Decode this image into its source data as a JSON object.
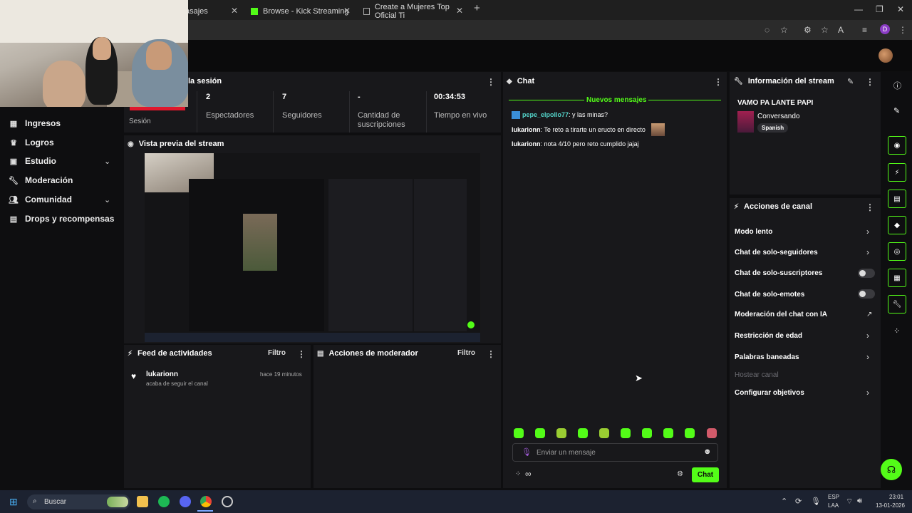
{
  "browser": {
    "tabs": [
      {
        "label": "asajes"
      },
      {
        "label": "Browse - Kick Streaming"
      },
      {
        "label": "Create a Mujeres Top Oficial Ti"
      }
    ],
    "profile_initial": "D"
  },
  "sidebar": {
    "items": [
      {
        "label": "Ingresos",
        "icon": "income-icon"
      },
      {
        "label": "Logros",
        "icon": "trophy-icon"
      },
      {
        "label": "Estudio",
        "icon": "studio-icon"
      },
      {
        "label": "Moderación",
        "icon": "wrench-icon"
      },
      {
        "label": "Comunidad",
        "icon": "community-icon"
      },
      {
        "label": "Drops y recompensas",
        "icon": "drops-icon"
      }
    ]
  },
  "session": {
    "title": "la sesión",
    "first_label": "Sesión",
    "stats": [
      {
        "value": "2",
        "label": "Espectadores"
      },
      {
        "value": "7",
        "label": "Seguidores"
      },
      {
        "value": "-",
        "label": "Cantidad de suscripciones"
      },
      {
        "value": "00:34:53",
        "label": "Tiempo en vivo"
      }
    ]
  },
  "preview": {
    "title": "Vista previa del stream"
  },
  "activity": {
    "title": "Feed de actividades",
    "filter": "Filtro",
    "item": {
      "user": "lukarionn",
      "time": "hace 19 minutos",
      "text": "acaba de seguir el canal"
    }
  },
  "mod_actions": {
    "title": "Acciones de moderador",
    "filter": "Filtro"
  },
  "chat": {
    "title": "Chat",
    "new_messages": "Nuevos mensajes",
    "messages": [
      {
        "user": "pepe_elpollo77",
        "text": ": y las minas?",
        "color": "#53d2c8"
      },
      {
        "user": "lukarionn",
        "text": ": Te reto a tirarte un eructo en directo",
        "color": "#ffffff"
      },
      {
        "user": "lukarionn",
        "text": ": nota 4/10 pero reto cumplido jajaj",
        "color": "#ffffff"
      }
    ],
    "input_placeholder": "Enviar un mensaje",
    "send_label": "Chat"
  },
  "stream_info": {
    "title": "Información del stream",
    "stream_title": "VAMO PA LANTE PAPI",
    "category": "Conversando",
    "language": "Spanish"
  },
  "channel_actions": {
    "title": "Acciones de canal",
    "items": [
      {
        "label": "Modo lento",
        "control": "chevron"
      },
      {
        "label": "Chat de solo-seguidores",
        "control": "chevron"
      },
      {
        "label": "Chat de solo-suscriptores",
        "control": "toggle"
      },
      {
        "label": "Chat de solo-emotes",
        "control": "toggle"
      },
      {
        "label": "Moderación del chat con IA",
        "control": "external"
      },
      {
        "label": "Restricción de edad",
        "control": "chevron"
      },
      {
        "label": "Palabras baneadas",
        "control": "chevron"
      },
      {
        "label": "Hostear canal",
        "control": "none"
      },
      {
        "label": "Configurar objetivos",
        "control": "chevron"
      }
    ]
  },
  "taskbar": {
    "search_label": "Buscar",
    "lang": "ESP",
    "layout": "LAA",
    "time": "23:01",
    "date": "13-01-2026"
  },
  "colors": {
    "accent": "#53fc18",
    "panel": "#18181b",
    "background": "#0e0e10"
  }
}
